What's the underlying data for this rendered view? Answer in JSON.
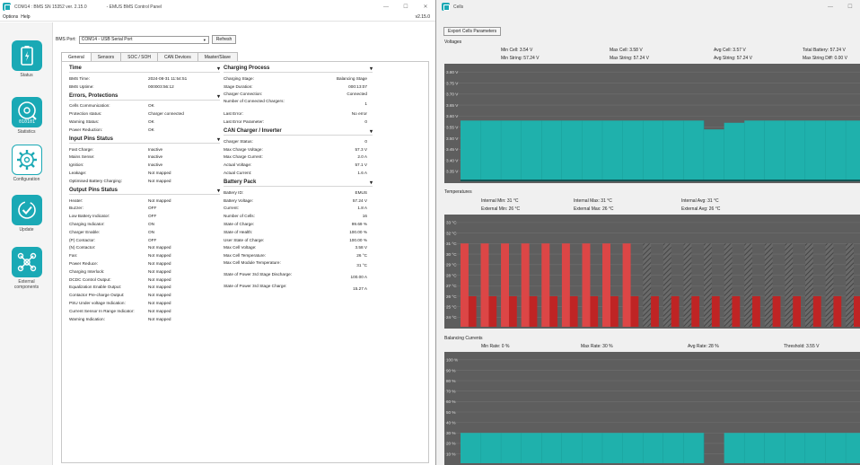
{
  "left_window": {
    "title": "COM14 : BMS SN 15352 ver. 2.15.0",
    "app_name": "- EMUS BMS Control Panel",
    "menu": [
      "Options",
      "Help"
    ],
    "version": "v2.15.0",
    "window_controls": [
      "—",
      "☐",
      "✕"
    ]
  },
  "sidebar": [
    {
      "label": "Status",
      "icon": "battery-icon",
      "active": true
    },
    {
      "label": "Statistics",
      "icon": "statistics-icon",
      "active": false
    },
    {
      "label": "Configuration",
      "icon": "configuration-gear-icon",
      "active": false
    },
    {
      "label": "Update",
      "icon": "update-check-icon",
      "active": false
    },
    {
      "label": "External components",
      "icon": "external-components-icon",
      "active": false
    }
  ],
  "port": {
    "label": "BMS Port:",
    "selected": "COM14 - USB Serial Port",
    "refresh_label": "Refresh"
  },
  "tabs": [
    "General",
    "Sensors",
    "SOC / SOH",
    "CAN Devices",
    "Master/Slave"
  ],
  "time": {
    "title": "Time",
    "rows": [
      [
        "BMS Time:",
        "2024-08-31 11:54:51"
      ],
      [
        "BMS Uptime:",
        "000003:56:12"
      ]
    ]
  },
  "errors": {
    "title": "Errors, Protections",
    "rows": [
      [
        "Cells Communication:",
        "OK"
      ],
      [
        "Protection status:",
        "Charger connected"
      ],
      [
        "Warning Status:",
        "OK"
      ],
      [
        "Power Reduction:",
        "OK"
      ]
    ]
  },
  "input_pins": {
    "title": "Input Pins Status",
    "rows": [
      [
        "Fast Charge:",
        "Inactive"
      ],
      [
        "Mains Sense:",
        "Inactive"
      ],
      [
        "Ignition:",
        "Inactive"
      ],
      [
        "Leakage:",
        "Not mapped"
      ],
      [
        "Optimised Battery Charging:",
        "Not mapped"
      ]
    ]
  },
  "output_pins": {
    "title": "Output Pins Status",
    "rows": [
      [
        "Heater:",
        "Not mapped"
      ],
      [
        "Buzzer:",
        "OFF"
      ],
      [
        "Low Battery Indicator:",
        "OFF"
      ],
      [
        "Charging Indicator:",
        "ON"
      ],
      [
        "Charger Enable:",
        "ON"
      ],
      [
        "(P) Contactor:",
        "OFF"
      ],
      [
        "(N) Contactor:",
        "Not mapped"
      ],
      [
        "Fan:",
        "Not mapped"
      ],
      [
        "Power Reduce:",
        "Not mapped"
      ],
      [
        "Charging Interlock:",
        "Not mapped"
      ],
      [
        "DCDC Control Output:",
        "Not mapped"
      ],
      [
        "Equalization Enable Output:",
        "Not mapped"
      ],
      [
        "Contactor Pre-charge Output:",
        "Not mapped"
      ],
      [
        "PSU Under voltage Indication:",
        "Not mapped"
      ],
      [
        "Current Sensor In Range Indicator:",
        "Not mapped"
      ],
      [
        "Warning Indication:",
        "Not mapped"
      ]
    ]
  },
  "charging": {
    "title": "Charging Process",
    "rows": [
      [
        "Charging Stage:",
        "Balancing Stage"
      ],
      [
        "Stage Duration:",
        "000:13:07"
      ],
      [
        "Charger Connection:",
        "Connected"
      ],
      [
        "Number of Connected Chargers:",
        "1"
      ],
      [
        "Last Error:",
        "No error"
      ],
      [
        "Last Error Parameter:",
        "0"
      ]
    ]
  },
  "can_charger": {
    "title": "CAN Charger / Inverter",
    "rows": [
      [
        "Charger Status:",
        "0"
      ],
      [
        "Max Charge Voltage:",
        "57.3  V"
      ],
      [
        "Max Charge Current:",
        "2.0  A"
      ],
      [
        "Actual Voltage:",
        "57.1  V"
      ],
      [
        "Actual Current:",
        "1.6  A"
      ]
    ]
  },
  "battery_pack": {
    "title": "Battery Pack",
    "rows": [
      [
        "Battery ID:",
        "EMUS"
      ],
      [
        "Battery Voltage:",
        "57.24  V"
      ],
      [
        "Current:",
        "1.8  A"
      ],
      [
        "Number of Cells:",
        "16"
      ],
      [
        "State of Charge:",
        "99.69  %"
      ],
      [
        "State of Health:",
        "100.00  %"
      ],
      [
        "User State of Charge:",
        "100.00  %"
      ],
      [
        "Max Cell Voltage:",
        "3.58  V"
      ],
      [
        "Max Cell Temperature:",
        "26  °C"
      ],
      [
        "Max Cell Module Temperature:",
        "31  °C"
      ],
      [
        "State of Power 3rd Stage Discharge:",
        "100.00  A"
      ],
      [
        "State of Power 3rd Stage Charge:",
        "15.27  A"
      ]
    ]
  },
  "right_window": {
    "title": "Cells",
    "export_label": "Export Cells Parameters",
    "window_controls": [
      "—",
      "☐"
    ]
  },
  "voltages": {
    "label": "Voltages",
    "stats": [
      "Min Cell: 3.54 V",
      "Max Cell: 3.58 V",
      "Avg Cell: 3.57 V",
      "Total Battery: 57.24 V",
      "Min String: 57.24 V",
      "Max String: 57.24 V",
      "Avg String: 57.24 V",
      "Max String Diff: 0.00 V"
    ]
  },
  "temperatures": {
    "label": "Temperatures",
    "stats": [
      "Internal Min: 31 °C",
      "Internal Max: 31 °C",
      "Internal Avg: 31 °C",
      "External Min: 26 °C",
      "External Max: 26 °C",
      "External Avg: 26 °C"
    ]
  },
  "balancing": {
    "label": "Balancing Currents",
    "stats": [
      "Min Rate: 0 %",
      "Max Rate: 30 %",
      "Avg Rate: 28 %",
      "Threshold: 3.55 V"
    ]
  },
  "chart_data": [
    {
      "type": "bar",
      "title": "Voltages",
      "y_ticks": [
        "3.80 V",
        "3.75 V",
        "3.70 V",
        "3.65 V",
        "3.60 V",
        "3.55 V",
        "3.50 V",
        "3.45 V",
        "3.40 V",
        "3.35 V"
      ],
      "ylim": [
        3.3,
        3.8
      ],
      "values": [
        3.58,
        3.58,
        3.58,
        3.58,
        3.58,
        3.58,
        3.58,
        3.58,
        3.58,
        3.58,
        3.58,
        3.58,
        3.54,
        3.57,
        3.58,
        3.58,
        3.58,
        3.58,
        3.58,
        3.58
      ],
      "colors": {
        "bar": "#1fb1ac",
        "background": "#5e5e5e",
        "grid": "#707070",
        "baseline": "#0e5756"
      }
    },
    {
      "type": "bar",
      "title": "Temperatures",
      "y_ticks": [
        "33 °C",
        "32 °C",
        "31 °C",
        "30 °C",
        "29 °C",
        "28 °C",
        "27 °C",
        "26 °C",
        "25 °C",
        "24 °C"
      ],
      "ylim": [
        23,
        33
      ],
      "series": [
        {
          "values": [
            26,
            26,
            26,
            26,
            26,
            26,
            26,
            26,
            26,
            26,
            26,
            26,
            26,
            26,
            26,
            26,
            26,
            26,
            26,
            26
          ]
        },
        {
          "values": [
            31,
            31,
            31,
            31,
            31,
            31,
            31,
            31,
            31,
            31,
            31,
            31,
            31,
            31,
            31,
            31,
            31,
            31,
            31,
            31
          ]
        }
      ],
      "hatched_from_index": 9,
      "colors": {
        "external": "#bf2424",
        "internal": "#dc4646",
        "hatch": "#444444",
        "background": "#5e5e5e",
        "grid": "#707070"
      }
    },
    {
      "type": "bar",
      "title": "Balancing Currents",
      "y_ticks": [
        "100 %",
        "90 %",
        "80 %",
        "70 %",
        "60 %",
        "50 %",
        "40 %",
        "30 %",
        "20 %",
        "10 %"
      ],
      "ylim": [
        0,
        100
      ],
      "values": [
        30,
        30,
        30,
        30,
        30,
        30,
        30,
        30,
        30,
        30,
        30,
        30,
        0,
        30,
        30,
        30,
        30,
        30,
        30,
        30
      ],
      "colors": {
        "bar": "#1fb1ac",
        "background": "#5e5e5e",
        "grid": "#707070"
      }
    }
  ]
}
